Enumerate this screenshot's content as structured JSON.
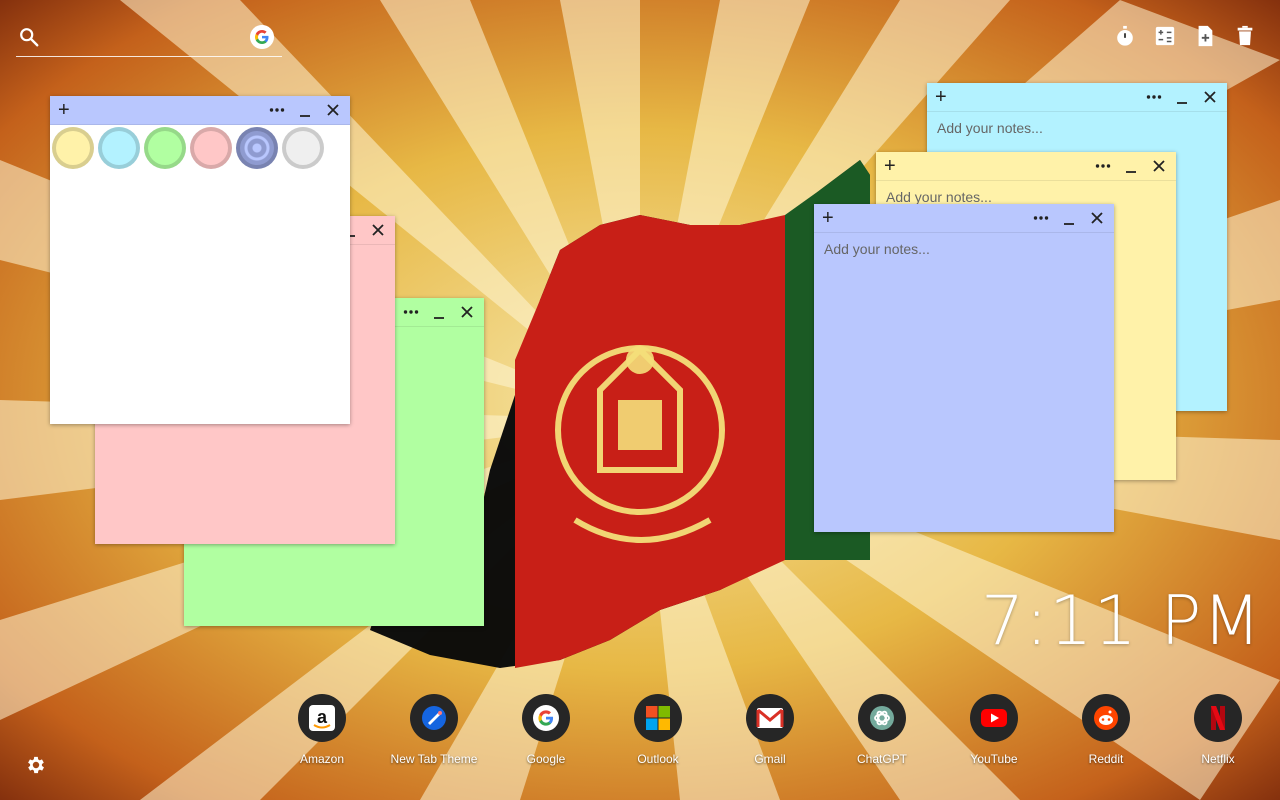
{
  "search": {
    "placeholder": ""
  },
  "clock": {
    "time": "7:11 PM"
  },
  "notes": {
    "placeholder": "Add your notes...",
    "colors": {
      "white": "#ffffff",
      "pink": "#ffc7c7",
      "green": "#b1ffa1",
      "blue": "#b9c7fe",
      "yellow": "#fff2a9",
      "cyan": "#b3f2ff"
    },
    "palette": [
      {
        "name": "yellow",
        "color": "#fff2a9"
      },
      {
        "name": "cyan",
        "color": "#b3f2ff"
      },
      {
        "name": "green",
        "color": "#b1ffa1"
      },
      {
        "name": "pink",
        "color": "#ffc7c7"
      },
      {
        "name": "blue",
        "color": "#9aa4d6"
      },
      {
        "name": "white",
        "color": "#efefef"
      }
    ]
  },
  "dock": [
    {
      "label": "Amazon",
      "icon": "amazon-icon"
    },
    {
      "label": "New Tab Theme",
      "icon": "new-tab-theme-icon"
    },
    {
      "label": "Google",
      "icon": "google-icon"
    },
    {
      "label": "Outlook",
      "icon": "outlook-icon"
    },
    {
      "label": "Gmail",
      "icon": "gmail-icon"
    },
    {
      "label": "ChatGPT",
      "icon": "chatgpt-icon"
    },
    {
      "label": "YouTube",
      "icon": "youtube-icon"
    },
    {
      "label": "Reddit",
      "icon": "reddit-icon"
    },
    {
      "label": "Netflix",
      "icon": "netflix-icon"
    }
  ]
}
